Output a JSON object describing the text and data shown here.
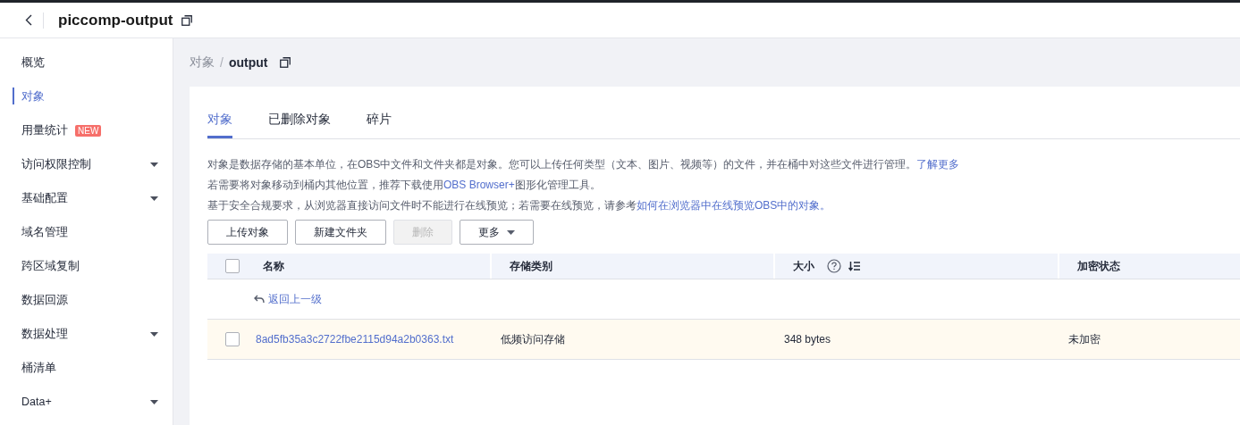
{
  "header": {
    "title": "piccomp-output"
  },
  "sidebar": {
    "items": [
      {
        "label": "概览",
        "selected": false,
        "expandable": false
      },
      {
        "label": "对象",
        "selected": true,
        "expandable": false
      },
      {
        "label": "用量统计",
        "selected": false,
        "expandable": false,
        "badge": "NEW"
      },
      {
        "label": "访问权限控制",
        "selected": false,
        "expandable": true
      },
      {
        "label": "基础配置",
        "selected": false,
        "expandable": true
      },
      {
        "label": "域名管理",
        "selected": false,
        "expandable": false
      },
      {
        "label": "跨区域复制",
        "selected": false,
        "expandable": false
      },
      {
        "label": "数据回源",
        "selected": false,
        "expandable": false
      },
      {
        "label": "数据处理",
        "selected": false,
        "expandable": true
      },
      {
        "label": "桶清单",
        "selected": false,
        "expandable": false
      },
      {
        "label": "Data+",
        "selected": false,
        "expandable": true
      }
    ]
  },
  "breadcrumb": {
    "parent": "对象",
    "separator": "/",
    "current": "output"
  },
  "tabs": [
    {
      "label": "对象",
      "selected": true
    },
    {
      "label": "已删除对象",
      "selected": false
    },
    {
      "label": "碎片",
      "selected": false
    }
  ],
  "info_lines": [
    [
      {
        "kind": "text",
        "text": "对象是数据存储的基本单位，在OBS中文件和文件夹都是对象。您可以上传任何类型（文本、图片、视频等）的文件，并在桶中对这些文件进行管理。"
      },
      {
        "kind": "link",
        "text": "了解更多"
      }
    ],
    [
      {
        "kind": "text",
        "text": "若需要将对象移动到桶内其他位置，推荐下载使用"
      },
      {
        "kind": "link",
        "text": "OBS Browser+"
      },
      {
        "kind": "text",
        "text": "图形化管理工具。"
      }
    ],
    [
      {
        "kind": "text",
        "text": "基于安全合规要求，从浏览器直接访问文件时不能进行在线预览；若需要在线预览，请参考"
      },
      {
        "kind": "link",
        "text": "如何在浏览器中在线预览OBS中的对象。"
      }
    ]
  ],
  "buttons": [
    {
      "label": "上传对象",
      "disabled": false,
      "dropdown": false
    },
    {
      "label": "新建文件夹",
      "disabled": false,
      "dropdown": false
    },
    {
      "label": "删除",
      "disabled": true,
      "dropdown": false
    },
    {
      "label": "更多",
      "disabled": false,
      "dropdown": true
    }
  ],
  "table": {
    "select_all": false,
    "columns": [
      {
        "label": "名称",
        "help": false,
        "sortable": false
      },
      {
        "label": "存储类别",
        "help": false,
        "sortable": false
      },
      {
        "label": "大小",
        "help": true,
        "sortable": true
      },
      {
        "label": "加密状态",
        "help": false,
        "sortable": false
      }
    ],
    "back_link": "返回上一级",
    "rows": [
      {
        "checked": false,
        "cells": [
          "8ad5fb35a3c2722fbe2115d94a2b0363.txt",
          "低频访问存储",
          "348 bytes",
          "未加密"
        ]
      }
    ]
  }
}
